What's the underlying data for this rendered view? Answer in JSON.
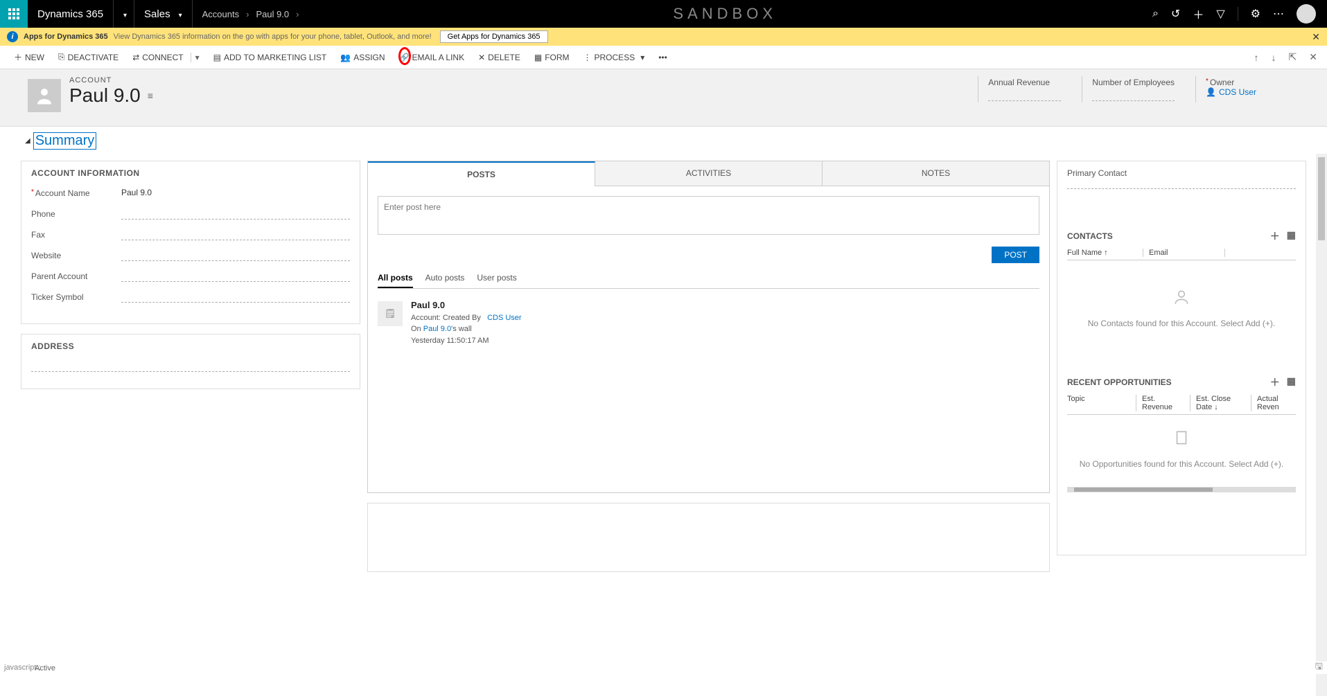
{
  "topbar": {
    "brand": "Dynamics 365",
    "area": "Sales",
    "crumb1": "Accounts",
    "crumb2": "Paul 9.0",
    "sandbox": "SANDBOX"
  },
  "infobar": {
    "title": "Apps for Dynamics 365",
    "desc": "View Dynamics 365 information on the go with apps for your phone, tablet, Outlook, and more!",
    "button": "Get Apps for Dynamics 365"
  },
  "cmdbar": {
    "new": "NEW",
    "deactivate": "DEACTIVATE",
    "connect": "CONNECT",
    "addToMarketing": "ADD TO MARKETING LIST",
    "assign": "ASSIGN",
    "emailLink": "EMAIL A LINK",
    "delete": "DELETE",
    "form": "FORM",
    "process": "PROCESS"
  },
  "header": {
    "entity": "ACCOUNT",
    "name": "Paul 9.0",
    "metrics": {
      "annualRevenue": "Annual Revenue",
      "employees": "Number of Employees",
      "owner": "Owner",
      "ownerValue": "CDS User"
    }
  },
  "summary": {
    "title": "Summary",
    "acctInfo": {
      "heading": "ACCOUNT INFORMATION",
      "accountNameLabel": "Account Name",
      "accountNameValue": "Paul 9.0",
      "phone": "Phone",
      "fax": "Fax",
      "website": "Website",
      "parent": "Parent Account",
      "ticker": "Ticker Symbol"
    },
    "address": {
      "heading": "ADDRESS"
    }
  },
  "social": {
    "tabs": {
      "posts": "POSTS",
      "activities": "ACTIVITIES",
      "notes": "NOTES"
    },
    "placeholder": "Enter post here",
    "postBtn": "POST",
    "filters": {
      "all": "All posts",
      "auto": "Auto posts",
      "user": "User posts"
    },
    "post1": {
      "title": "Paul 9.0",
      "line1a": "Account: Created By",
      "line1b": "CDS User",
      "line2a": "On ",
      "line2b": "Paul 9.0",
      "line2c": "'s wall",
      "line3": "Yesterday 11:50:17 AM"
    }
  },
  "rightcol": {
    "primaryContact": "Primary Contact",
    "contacts": {
      "heading": "CONTACTS",
      "cols": {
        "fullName": "Full Name ↑",
        "email": "Email"
      },
      "empty": "No Contacts found for this Account. Select Add (+)."
    },
    "opps": {
      "heading": "RECENT OPPORTUNITIES",
      "cols": {
        "topic": "Topic",
        "estRev": "Est. Revenue",
        "estClose": "Est. Close Date ↓",
        "actualRev": "Actual Reven"
      },
      "empty": "No Opportunities found for this Account. Select Add (+)."
    }
  },
  "status": {
    "left": "javascript:;",
    "active": "Active"
  }
}
